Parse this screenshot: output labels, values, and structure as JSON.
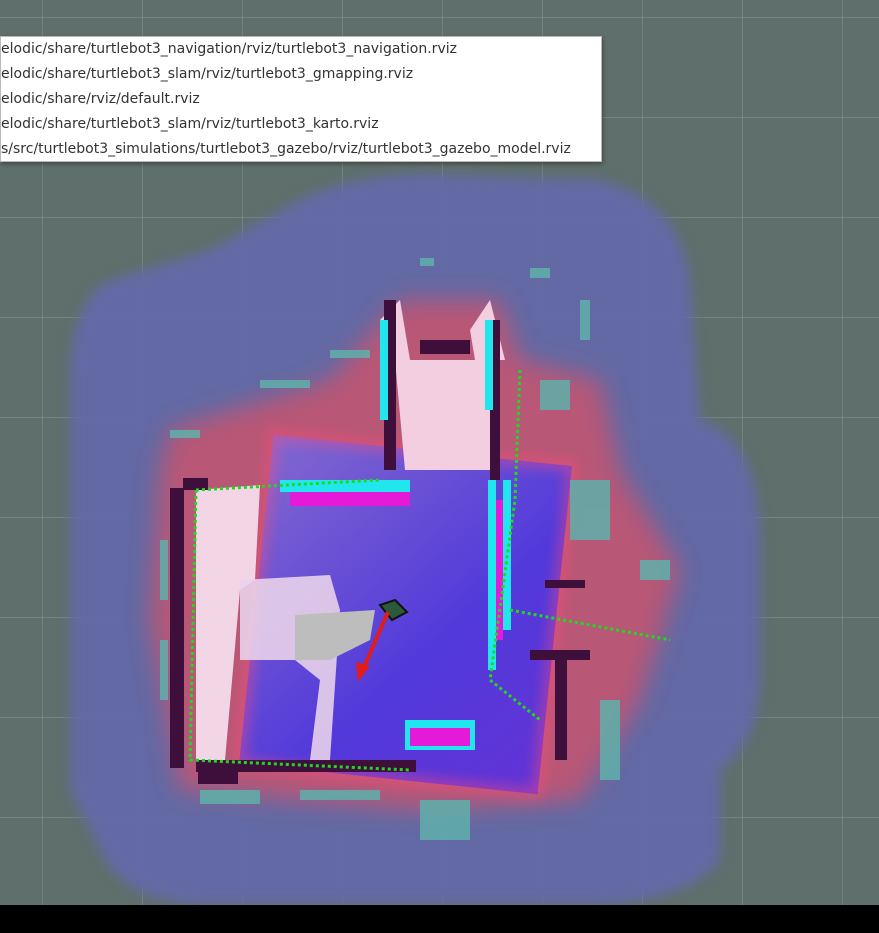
{
  "recent_configs": [
    "elodic/share/turtlebot3_navigation/rviz/turtlebot3_navigation.rviz",
    "elodic/share/turtlebot3_slam/rviz/turtlebot3_gmapping.rviz",
    "elodic/share/rviz/default.rviz",
    "elodic/share/turtlebot3_slam/rviz/turtlebot3_karto.rviz",
    "s/src/turtlebot3_simulations/turtlebot3_gazebo/rviz/turtlebot3_gazebo_model.rviz"
  ],
  "colors": {
    "background": "#5f6f6b",
    "grid": "#8a9894",
    "costmap_outer": "#6366a6",
    "inflation": "#e0506f",
    "lethal": "#e41ad8",
    "inscribed": "#22e6ee",
    "walls": "#3d0f3a",
    "free_space": "#f2d6e6",
    "path": "#1ed91e",
    "pose_arrow": "#e21b1b",
    "robot": "#2b5a3a"
  }
}
